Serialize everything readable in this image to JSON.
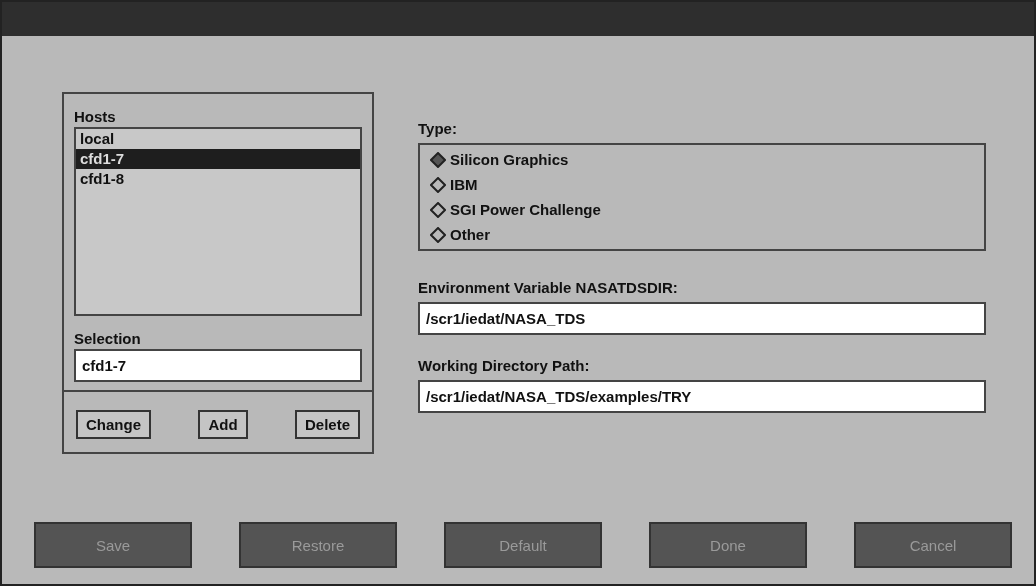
{
  "hosts": {
    "label": "Hosts",
    "items": [
      {
        "label": "local",
        "selected": false
      },
      {
        "label": "cfd1-7",
        "selected": true
      },
      {
        "label": "cfd1-8",
        "selected": false
      }
    ]
  },
  "selection": {
    "label": "Selection",
    "value": "cfd1-7"
  },
  "host_buttons": [
    "Change",
    "Add",
    "Delete"
  ],
  "type": {
    "label": "Type:",
    "options": [
      {
        "label": "Silicon Graphics",
        "selected": true
      },
      {
        "label": "IBM",
        "selected": false
      },
      {
        "label": "SGI Power Challenge",
        "selected": false
      },
      {
        "label": "Other",
        "selected": false
      }
    ]
  },
  "fields": [
    {
      "label": "Environment Variable NASATDSDIR:",
      "value": "/scr1/iedat/NASA_TDS"
    },
    {
      "label": "Working Directory Path:",
      "value": "/scr1/iedat/NASA_TDS/examples/TRY"
    }
  ],
  "buttons": [
    "Save",
    "Restore",
    "Default",
    "Done",
    "Cancel"
  ]
}
